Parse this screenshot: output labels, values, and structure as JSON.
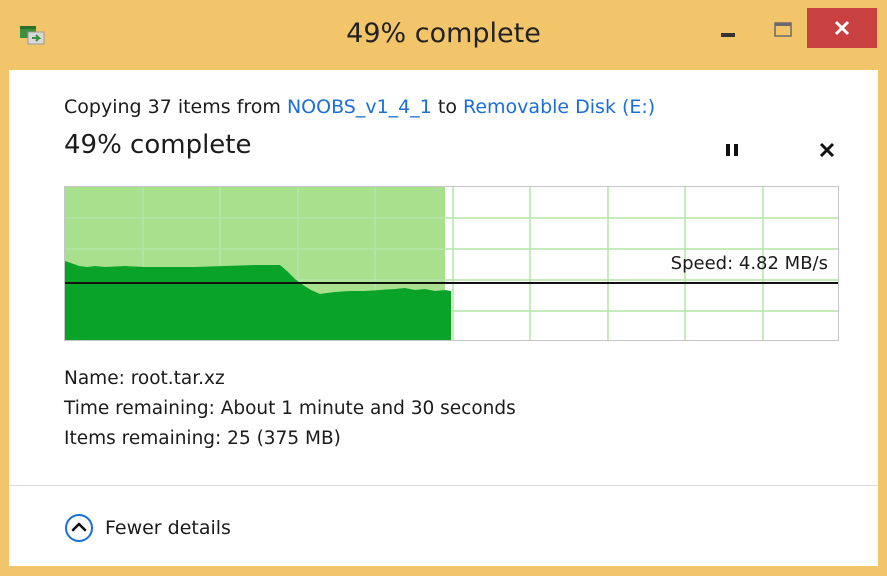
{
  "window": {
    "title": "49% complete",
    "accent": "#f2c56a",
    "close_color": "#c84040"
  },
  "icons": {
    "app": "copy-icon",
    "minimize": "minimize-icon",
    "maximize": "maximize-icon",
    "close": "close-icon",
    "pause": "pause-icon",
    "cancel": "cancel-icon",
    "collapse": "chevron-up-icon"
  },
  "copy": {
    "prefix": "Copying 37 items from ",
    "source": "NOOBS_v1_4_1",
    "middle": " to ",
    "destination": "Removable Disk (E:)",
    "percent_text": "49% complete",
    "progress": 0.49,
    "speed_text": "Speed: 4.82 MB/s"
  },
  "details": {
    "name_label": "Name:",
    "name_value": "root.tar.xz",
    "time_label": "Time remaining:",
    "time_value": "About 1 minute and 30 seconds",
    "items_label": "Items remaining:",
    "items_value": "25 (375 MB)"
  },
  "footer": {
    "toggle_label": "Fewer details"
  },
  "colors": {
    "progress_fill": "#a8e08e",
    "speed_fill": "#0aa32a",
    "grid": "#b4e6a6",
    "link": "#1c6ed6"
  }
}
